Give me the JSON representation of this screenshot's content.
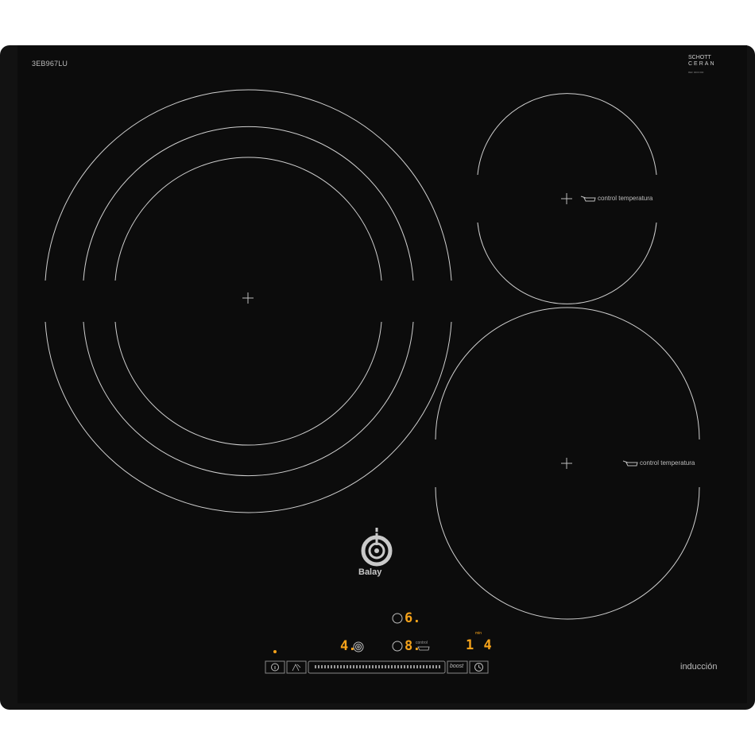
{
  "model": "3EB967LU",
  "certification": {
    "line1": "SCHOTT",
    "line2": "CERAN",
    "fine_print": "REF 0000 000"
  },
  "zones": {
    "top_right_label": "control temperatura",
    "bottom_right_label": "control temperatura"
  },
  "brand": "Balay",
  "panel": {
    "indicator_top_value": "6.",
    "indicator_mid_value": "8.",
    "mid_control_label": "control",
    "power_level": "4.",
    "timer_value": "1 4",
    "timer_unit": "min",
    "boost_label": "boost"
  },
  "footer_label": "inducción",
  "colors": {
    "glass": "#0c0c0c",
    "rim": "#121212",
    "lines": "#d0d0d0",
    "display": "#f5a21a"
  },
  "icons": [
    "crosshair-icon",
    "pan-icon",
    "info-icon",
    "clean-icon",
    "timer-icon",
    "coil-icon",
    "power-indicator-dot"
  ]
}
